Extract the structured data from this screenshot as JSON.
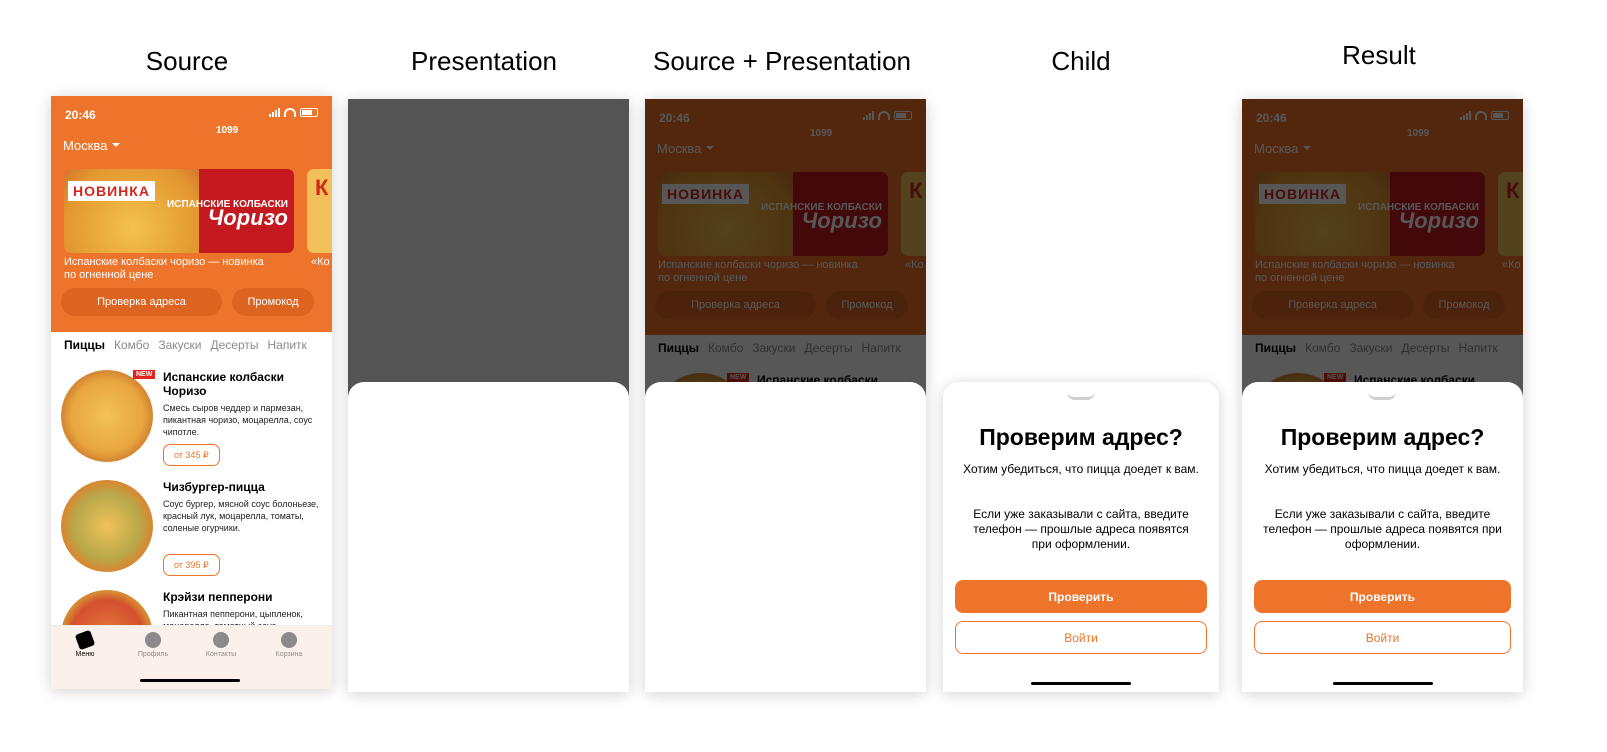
{
  "columns": {
    "source": "Source",
    "presentation": "Presentation",
    "source_presentation": "Source + Presentation",
    "child": "Child",
    "result": "Result"
  },
  "app": {
    "time": "20:46",
    "coins": "1099",
    "city": "Москва",
    "banner_badge": "НОВИНКА",
    "banner_brand_top": "ИСПАНСКИЕ КОЛБАСКИ",
    "banner_brand_main": "Чоризо",
    "banner_caption": "Испанские колбаски чоризо — новинка по огненной цене",
    "banner2_caption": "«Ко",
    "check_address": "Проверка адреса",
    "promo": "Промокод",
    "tabs": [
      "Пиццы",
      "Комбо",
      "Закуски",
      "Десерты",
      "Напитк"
    ],
    "products": [
      {
        "name": "Испанские колбаски Чоризо",
        "desc": "Смесь сыров чеддер и пармезан, пикантная чоризо, моцарелла, соус чипотле.",
        "price": "от 345 ₽",
        "badge": "NEW"
      },
      {
        "name": "Чизбургер-пицца",
        "desc": "Соус бургер, мясной соус болоньезе, красный лук, моцарелла, томаты, соленые огурчики.",
        "price": "от 395 ₽"
      },
      {
        "name": "Крэйзи пепперони",
        "desc": "Пикантная пепперони, цыпленок, моцарелла, томатный соус"
      }
    ],
    "nav": [
      "Меню",
      "Профиль",
      "Контакты",
      "Корзина"
    ]
  },
  "sheet": {
    "title": "Проверим адрес?",
    "p1": "Хотим убедиться, что пицца доедет к вам.",
    "p2": "Если уже заказывали с сайта, введите телефон — прошлые адреса появятся при оформлении.",
    "primary": "Проверить",
    "secondary": "Войти"
  },
  "colors": {
    "accent": "#ef742b",
    "dim_overlay": "#545454"
  }
}
